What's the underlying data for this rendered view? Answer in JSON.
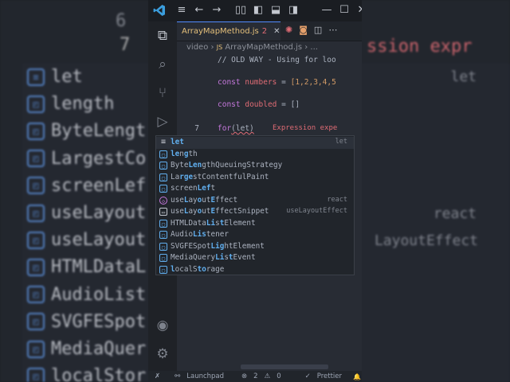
{
  "backdrop": {
    "line_number_top": "6",
    "line_number_seven": "7",
    "error_text": "ssion expr",
    "right_detail_let": "let",
    "right_detail_react": "react",
    "right_detail_layout": "LayoutEffect",
    "items": [
      "let",
      "length",
      "ByteLengt",
      "LargestCo",
      "screenLef",
      "useLayout",
      "useLayout",
      "HTMLDataL",
      "AudioList",
      "SVGFESpot",
      "MediaQuer",
      "localStor"
    ]
  },
  "titlebar": {
    "logo": "vscode-logo",
    "icons": [
      "menu-icon",
      "back-arrow-icon",
      "forward-arrow-icon",
      "layout-icon",
      "sidebar-icon",
      "panel-icon",
      "secondary-sidebar-icon",
      "minimize-icon",
      "maximize-icon",
      "close-icon"
    ],
    "glyphs": [
      "≡",
      "←",
      "→",
      "▯▯",
      "◧",
      "⬓",
      "◨",
      "—",
      "☐",
      "✕"
    ]
  },
  "activitybar": {
    "items": [
      {
        "name": "explorer-icon",
        "glyph": "⧉"
      },
      {
        "name": "search-icon",
        "glyph": "⌕"
      },
      {
        "name": "source-control-icon",
        "glyph": "⑂"
      },
      {
        "name": "run-debug-icon",
        "glyph": "▷"
      },
      {
        "name": "account-icon",
        "glyph": "◉"
      },
      {
        "name": "settings-gear-icon",
        "glyph": "⚙"
      }
    ]
  },
  "tab": {
    "filename": "ArrayMapMethod.js",
    "problems": "2",
    "close": "✕"
  },
  "breadcrumb": {
    "folder": "video",
    "file": "ArrayMapMethod.js",
    "more": "..."
  },
  "code": {
    "line1_comment": "// OLD WAY - Using for loo",
    "line3_kw": "const",
    "line3_var": "numbers",
    "line3_eq": "=",
    "line3_arr": "[1,2,3,4,5",
    "line5_kw": "const",
    "line5_var": "doubled",
    "line5_eq": "=",
    "line5_arr": "[]",
    "line7_kw": "for",
    "line7_rest": "(let)",
    "line7_num": "7",
    "error": "Expression expe"
  },
  "suggest": {
    "items": [
      {
        "label": "let",
        "detail": "let",
        "icon": "keyword"
      },
      {
        "label": "length",
        "detail": "",
        "icon": "variable"
      },
      {
        "label": "ByteLengthQueuingStrategy",
        "detail": "",
        "icon": "variable"
      },
      {
        "label": "LargestContentfulPaint",
        "detail": "",
        "icon": "variable"
      },
      {
        "label": "screenLeft",
        "detail": "",
        "icon": "variable"
      },
      {
        "label": "useLayoutEffect",
        "detail": "react",
        "icon": "module"
      },
      {
        "label": "useLayoutEffectSnippet",
        "detail": "useLayoutEffect",
        "icon": "snippet"
      },
      {
        "label": "HTMLDataListElement",
        "detail": "",
        "icon": "variable"
      },
      {
        "label": "AudioListener",
        "detail": "",
        "icon": "variable"
      },
      {
        "label": "SVGFESpotLightElement",
        "detail": "",
        "icon": "variable"
      },
      {
        "label": "MediaQueryListEvent",
        "detail": "",
        "icon": "variable"
      },
      {
        "label": "localStorage",
        "detail": "",
        "icon": "variable"
      }
    ]
  },
  "statusbar": {
    "remote": "✗",
    "launchpad": "Launchpad",
    "errors": "2",
    "warnings": "0",
    "prettier": "Prettier",
    "bell": "🔔"
  },
  "colors": {
    "accent": "#528bff",
    "error": "#e06c75",
    "keyword": "#c678dd",
    "number": "#d19a66",
    "tab_text": "#e5c07b"
  }
}
